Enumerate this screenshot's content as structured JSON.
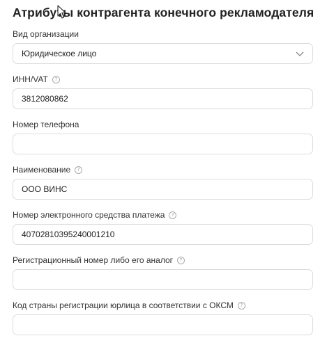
{
  "form": {
    "title": "Атрибуты контрагента конечного рекламодателя",
    "fields": [
      {
        "label": "Вид организации",
        "value": "Юридическое лицо",
        "help": false
      },
      {
        "label": "ИНН/VAT",
        "value": "3812080862",
        "help": true
      },
      {
        "label": "Номер телефона",
        "value": "",
        "help": false
      },
      {
        "label": "Наименование",
        "value": "ООО ВИНС",
        "help": true
      },
      {
        "label": "Номер электронного средства платежа",
        "value": "40702810395240001210",
        "help": true
      },
      {
        "label": "Регистрационный номер либо его аналог",
        "value": "",
        "help": true
      },
      {
        "label": "Код страны регистрации юрлица в соответствии с ОКСМ",
        "value": "",
        "help": true
      }
    ]
  },
  "icons": {
    "help": "question-circle-icon",
    "chevron": "chevron-down-icon",
    "cursor": "mouse-pointer-icon"
  }
}
